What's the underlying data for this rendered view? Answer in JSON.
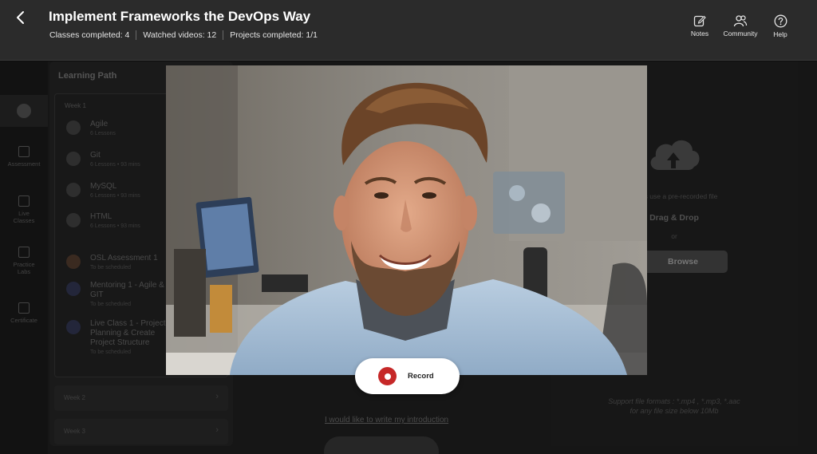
{
  "header": {
    "title": "Implement Frameworks the DevOps Way",
    "stats": [
      "Classes completed: 4",
      "Watched videos: 12",
      "Projects completed: 1/1"
    ],
    "actions": [
      {
        "label": "Notes",
        "icon": "notes-icon"
      },
      {
        "label": "Community",
        "icon": "community-icon"
      },
      {
        "label": "Help",
        "icon": "help-icon"
      }
    ]
  },
  "sidebar": {
    "items": [
      {
        "label": "",
        "icon": "course-icon"
      },
      {
        "label": "Assessment",
        "icon": "assessment-icon"
      },
      {
        "label": "Live Classes",
        "icon": "live-classes-icon"
      },
      {
        "label": "Practice Labs",
        "icon": "practice-labs-icon"
      },
      {
        "label": "Certificate",
        "icon": "certificate-icon"
      }
    ]
  },
  "learning_path": {
    "title": "Learning Path",
    "week1": "Week 1",
    "lessons": [
      {
        "name": "Agile",
        "sub": "6 Lessons"
      },
      {
        "name": "Git",
        "sub": "6 Lessons  •  93 mins"
      },
      {
        "name": "MySQL",
        "sub": "6 Lessons  •  93 mins"
      },
      {
        "name": "HTML",
        "sub": "6 Lessons  •  93 mins"
      },
      {
        "name": "OSL Assessment 1",
        "sub": "To be scheduled"
      },
      {
        "name": "Mentoring 1 - Agile &",
        "name2": "GIT",
        "sub": "To be scheduled"
      },
      {
        "name": "Live Class 1 - Project",
        "name2": "Planning & Create",
        "name3": "Project Structure",
        "sub": "To be scheduled"
      }
    ],
    "week2": "Week 2",
    "week3": "Week 3"
  },
  "upload": {
    "hint": "lways use a pre-recorded file",
    "drag_drop": "Drag & Drop",
    "or": "or",
    "browse": "Browse",
    "formats_line1": "Support file formats : *.mp4 , *.mp3, *.aac",
    "formats_line2": "for any file size below 10Mb"
  },
  "intro": {
    "write_link": "I would like to write my introduction"
  },
  "record": {
    "label": "Record"
  },
  "colors": {
    "record_red": "#c62828",
    "header_bg": "#2b2b2b"
  }
}
